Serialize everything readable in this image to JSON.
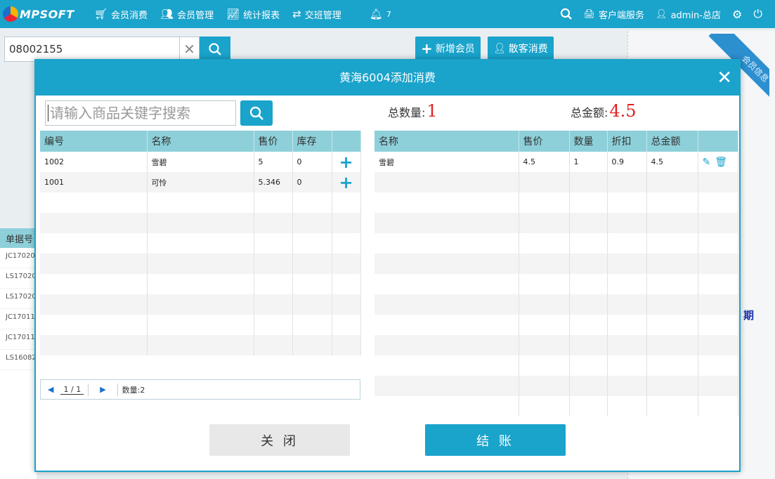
{
  "topbar": {
    "logo_text": "MPSOFT",
    "nav": [
      {
        "label": "会员消费",
        "icon": "cart-icon"
      },
      {
        "label": "会员管理",
        "icon": "users-icon"
      },
      {
        "label": "统计报表",
        "icon": "chart-icon"
      },
      {
        "label": "交班管理",
        "icon": "exchange-icon"
      }
    ],
    "bell_count": "7",
    "service_label": "客户端服务",
    "user_label": "admin-总店"
  },
  "bg": {
    "member_search_value": "08002155",
    "add_member_label": "新增会员",
    "walkin_label": "散客消费",
    "ribbon_text": "会员信息",
    "period_text": "期",
    "left_header": "单据号",
    "left_rows": [
      "JC17020",
      "LS17020",
      "LS17020",
      "JC17011",
      "JC17011",
      "LS16082"
    ]
  },
  "modal": {
    "title": "黄海6004添加消费",
    "search_placeholder": "请输入商品关键字搜索",
    "goods_columns": [
      "编号",
      "名称",
      "售价",
      "库存",
      ""
    ],
    "goods_rows": [
      {
        "code": "1002",
        "name": "雪碧",
        "price": "5",
        "stock": "0"
      },
      {
        "code": "1001",
        "name": "可怜",
        "price": "5.346",
        "stock": "0"
      }
    ],
    "pager": {
      "current": "1",
      "sep": "/",
      "total": "1",
      "count_label": "数量:2"
    },
    "total_qty_label": "总数量:",
    "total_qty": "1",
    "total_amount_label": "总金额:",
    "total_amount": "4.5",
    "cart_columns": [
      "名称",
      "售价",
      "数量",
      "折扣",
      "总金额",
      ""
    ],
    "cart_rows": [
      {
        "name": "雪碧",
        "price": "4.5",
        "qty": "1",
        "discount": "0.9",
        "amount": "4.5"
      }
    ],
    "close_label": "关 闭",
    "pay_label": "结 账"
  }
}
